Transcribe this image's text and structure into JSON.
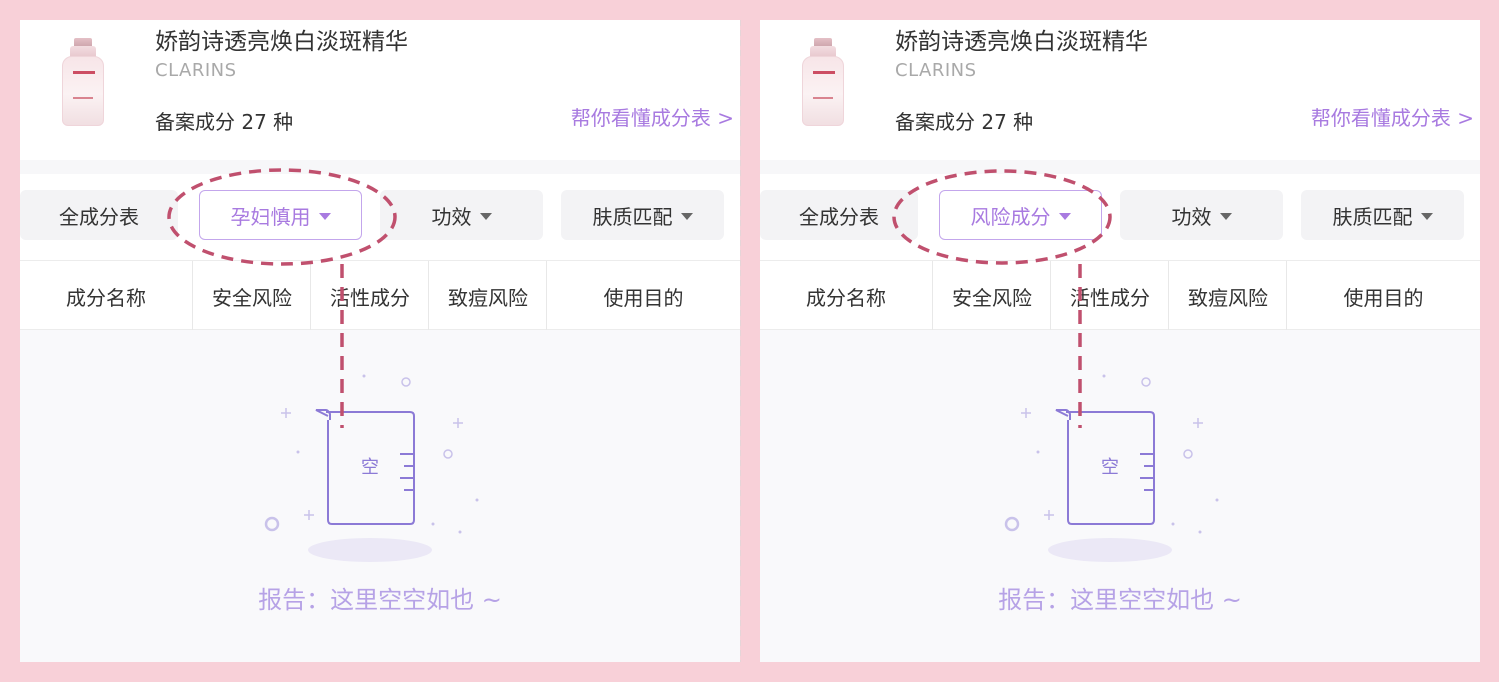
{
  "panels": [
    {
      "product": {
        "name": "娇韵诗透亮焕白淡斑精华",
        "brand": "CLARINS",
        "ingredient_count": "备案成分 27 种",
        "help_link": "帮你看懂成分表 >",
        "bottle_label": "CLARINS"
      },
      "filters": [
        {
          "label": "全成分表",
          "has_caret": false,
          "active": false
        },
        {
          "label": "孕妇慎用",
          "has_caret": true,
          "active": true
        },
        {
          "label": "功效",
          "has_caret": true,
          "active": false
        },
        {
          "label": "肤质匹配",
          "has_caret": true,
          "active": false
        }
      ],
      "table_headers": [
        "成分名称",
        "安全风险",
        "活性成分",
        "致痘风险",
        "使用目的"
      ],
      "empty_state": {
        "beaker_text": "空",
        "message": "报告：这里空空如也 ~"
      }
    },
    {
      "product": {
        "name": "娇韵诗透亮焕白淡斑精华",
        "brand": "CLARINS",
        "ingredient_count": "备案成分 27 种",
        "help_link": "帮你看懂成分表 >",
        "bottle_label": "CLARINS"
      },
      "filters": [
        {
          "label": "全成分表",
          "has_caret": false,
          "active": false
        },
        {
          "label": "风险成分",
          "has_caret": true,
          "active": true
        },
        {
          "label": "功效",
          "has_caret": true,
          "active": false
        },
        {
          "label": "肤质匹配",
          "has_caret": true,
          "active": false
        }
      ],
      "table_headers": [
        "成分名称",
        "安全风险",
        "活性成分",
        "致痘风险",
        "使用目的"
      ],
      "empty_state": {
        "beaker_text": "空",
        "message": "报告：这里空空如也 ~"
      }
    }
  ],
  "colors": {
    "accent": "#a87ae0",
    "annotation": "#c0506e",
    "background": "#f8d0d8"
  }
}
